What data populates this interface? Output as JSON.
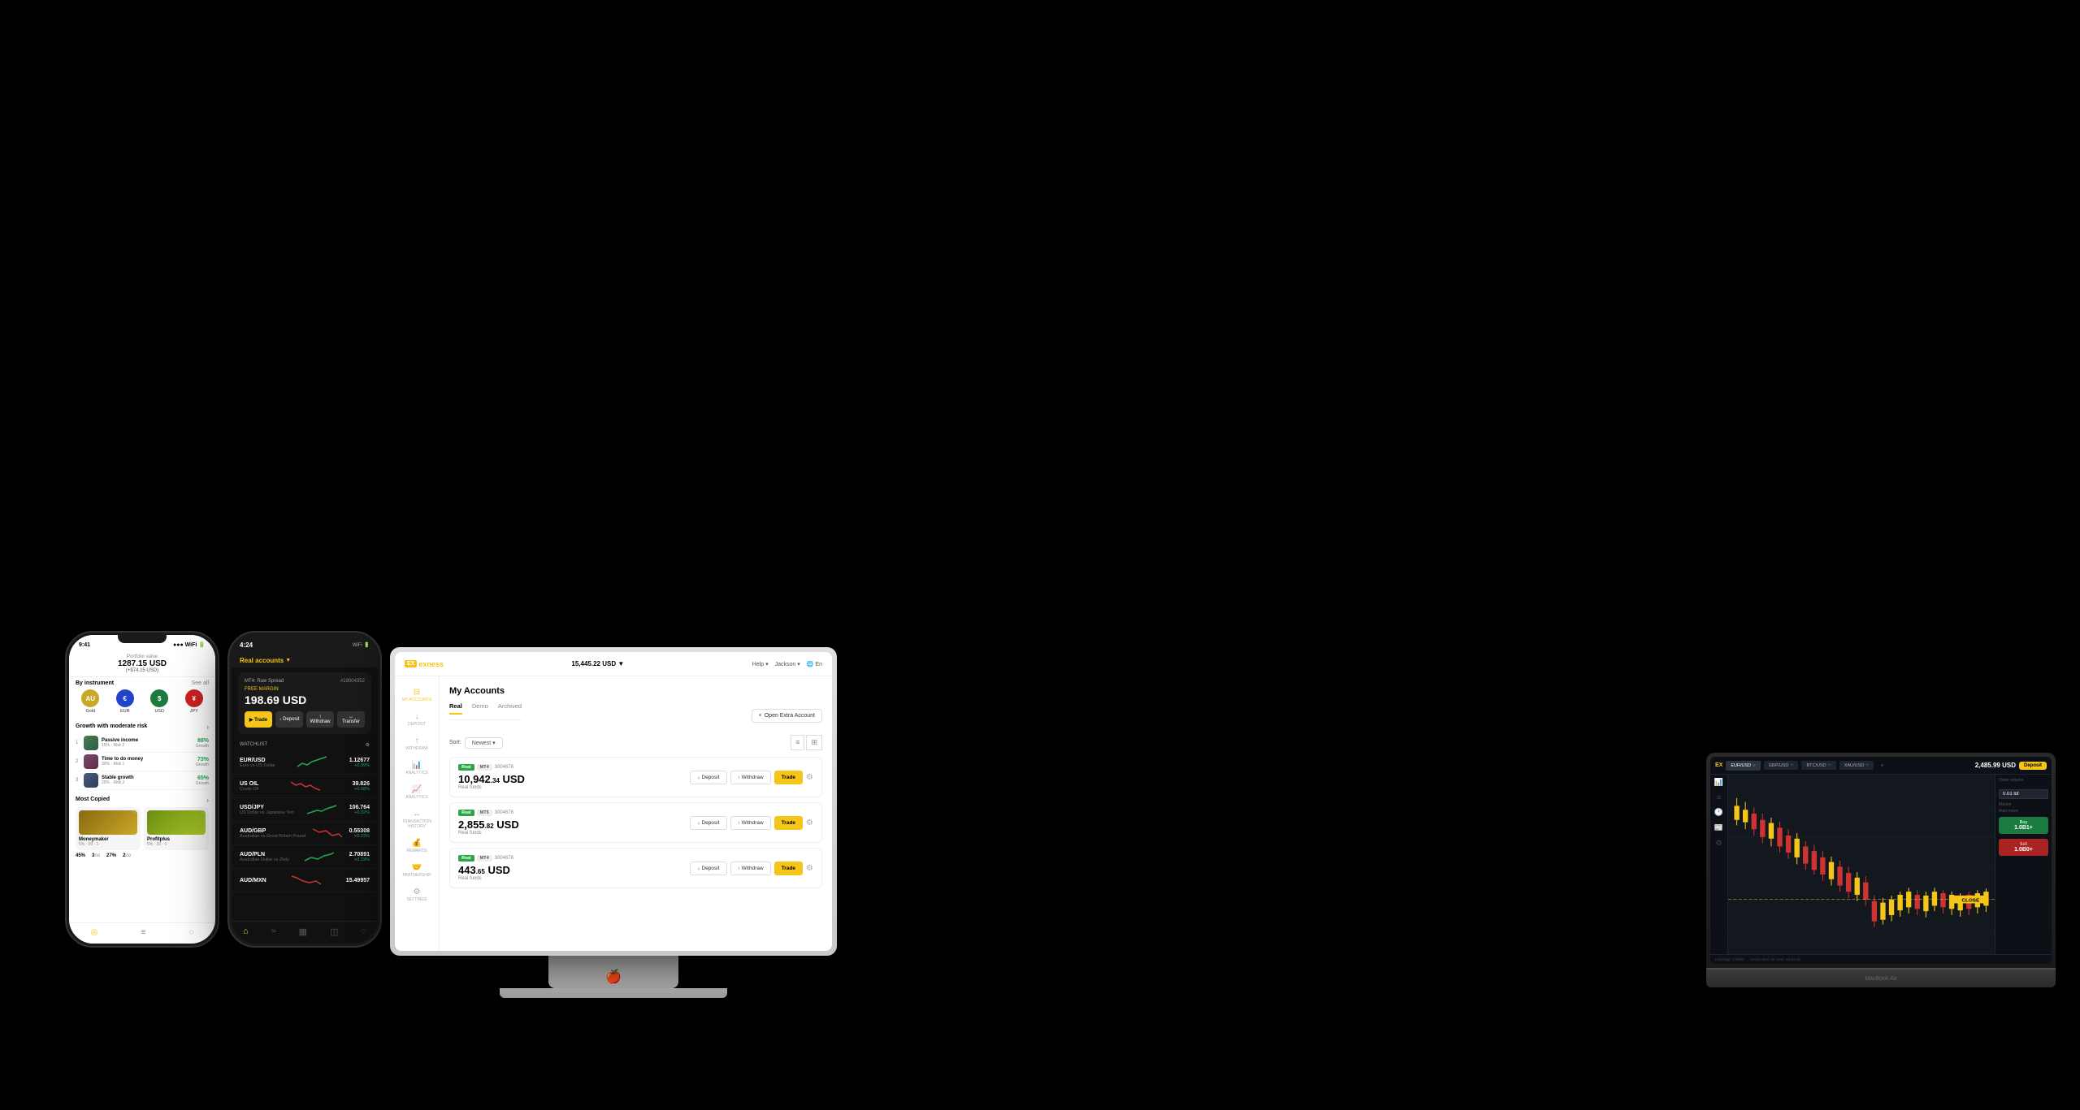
{
  "background": "#000000",
  "phone1": {
    "time": "9:41",
    "portfolio_label": "Portfolio value",
    "portfolio_value": "1287.15 USD",
    "portfolio_change": "(+$74.15 USD)",
    "by_instrument_label": "By instrument",
    "see_all": "See all",
    "instruments": [
      {
        "name": "Gold",
        "code": "AU",
        "color": "#c8a826"
      },
      {
        "name": "EUR",
        "code": "EU",
        "color": "#2244cc"
      },
      {
        "name": "USD",
        "code": "US",
        "color": "#1a7a3f"
      },
      {
        "name": "JPY",
        "code": "JP",
        "color": "#cc2222"
      }
    ],
    "growth_label": "Growth with moderate risk",
    "strategies": [
      {
        "rank": 1,
        "name": "Passive income",
        "meta": "15% · Risk 2",
        "pct": "88%",
        "growth": "Growth"
      },
      {
        "rank": 2,
        "name": "Time to do money",
        "meta": "30% · Risk 1",
        "pct": "73%",
        "growth": "Growth"
      },
      {
        "rank": 3,
        "name": "Stable growth",
        "meta": "25% · Risk 2",
        "pct": "65%",
        "growth": "Growth"
      }
    ],
    "most_copied_label": "Most Copied",
    "copied_traders": [
      {
        "name": "Moneymaker",
        "meta": "5% · 20 · 1"
      },
      {
        "name": "Profitplus",
        "meta": "5% · 20 · 1"
      }
    ],
    "stats": [
      {
        "value": "45%",
        "label": ""
      },
      {
        "value": "3",
        "label": "no"
      },
      {
        "value": "27%",
        "label": ""
      },
      {
        "value": "2",
        "label": "no"
      }
    ]
  },
  "phone2": {
    "time": "4:24",
    "accounts_label": "Real accounts",
    "card": {
      "tag": "FREE MARGIN",
      "type": "MT4: Raw Spread",
      "id": "#19004352",
      "value": "198.69 USD"
    },
    "actions": [
      "Trade",
      "Deposit",
      "Withdraw",
      "Transfer"
    ],
    "watchlist_label": "WATCHLIST",
    "watchlist": [
      {
        "name": "EUR/USD",
        "sub": "Euro vs US Dollar",
        "price": "1.12677",
        "change": "+0.39%",
        "up": true
      },
      {
        "name": "US OIL",
        "sub": "Crude Oil",
        "price": "39.826",
        "change": "+0.68%",
        "up": true
      },
      {
        "name": "USD/JPY",
        "sub": "US Dollar vs Japanese Yen",
        "price": "106.764",
        "change": "+0.32%",
        "up": true
      },
      {
        "name": "AUD/GBP",
        "sub": "Australian vs Great Britain Pound",
        "price": "0.55308",
        "change": "+0.23%",
        "up": true
      },
      {
        "name": "AUD/PLN",
        "sub": "Australian Dollar vs Zloty",
        "price": "2.70891",
        "change": "+0.19%",
        "up": true
      },
      {
        "name": "AUD/MXN",
        "sub": "",
        "price": "15.49957",
        "change": "",
        "up": false
      }
    ]
  },
  "monitor": {
    "logo": "exness",
    "balance": "15,445.22 USD",
    "balance_arrow": "▼",
    "nav_items": [
      "Help",
      "Jackson",
      "En"
    ],
    "sidebar_items": [
      {
        "icon": "⊟",
        "label": "MY ACCOUNTS",
        "active": true
      },
      {
        "icon": "↓",
        "label": "DEPOSIT"
      },
      {
        "icon": "↑",
        "label": "WITHDRAW"
      },
      {
        "icon": "📊",
        "label": "ANALYTICS"
      },
      {
        "icon": "📈",
        "label": "ANALYTICS"
      },
      {
        "icon": "↔",
        "label": "TRANSACTION HISTORY"
      },
      {
        "icon": "💰",
        "label": "REWARDS"
      },
      {
        "icon": "🤝",
        "label": "PARTNERSHIP"
      },
      {
        "icon": "⚙",
        "label": "SETTINGS"
      }
    ],
    "page_title": "My Accounts",
    "tabs": [
      "Real",
      "Demo",
      "Archived"
    ],
    "active_tab": "Real",
    "sort_label": "Sort:",
    "sort_value": "Newest",
    "open_extra_btn": "Open Extra Account",
    "accounts": [
      {
        "tags": [
          "Real",
          "MT4"
        ],
        "id": "3004678",
        "balance": "10,942",
        "balance_cents": ".34",
        "currency": "USD",
        "sub": "Real funds",
        "actions": [
          "Deposit",
          "Withdraw",
          "Trade"
        ]
      },
      {
        "tags": [
          "Real",
          "MT5"
        ],
        "id": "3004678",
        "balance": "2,855",
        "balance_cents": ".82",
        "currency": "USD",
        "sub": "Real funds",
        "actions": [
          "Deposit",
          "Withdraw",
          "Trade"
        ]
      },
      {
        "tags": [
          "Real",
          "MT4"
        ],
        "id": "3004678",
        "balance": "443",
        "balance_cents": ".65",
        "currency": "USD",
        "sub": "Real funds",
        "actions": [
          "Deposit",
          "Withdraw",
          "Trade"
        ]
      }
    ]
  },
  "laptop": {
    "brand": "MacBook Air",
    "trading": {
      "logo": "EX",
      "tabs": [
        "EUR/USD▾",
        "GBP/USD+",
        "BTC/USD+",
        "XAU/USD+"
      ],
      "balance": "2,485.99 USD",
      "deposit_btn": "Deposit",
      "order_volume": "0.01 lot",
      "market_label": "Market",
      "auto_move_label": "Auto move",
      "buy_price": "1.0B1+",
      "sell_price": "1.0B0+",
      "footer_left": "Leverage: 1:3000",
      "footer_right": "Server time: 24 June, 12:31:18"
    }
  }
}
